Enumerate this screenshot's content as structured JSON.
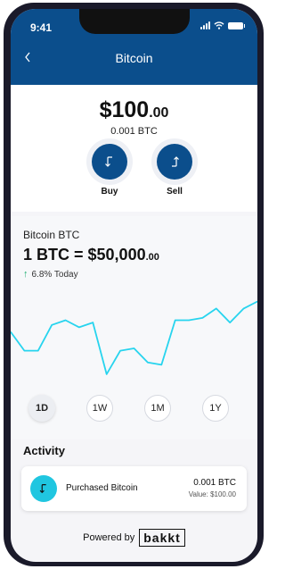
{
  "status_bar": {
    "time": "9:41",
    "signal_icon": "signal-icon",
    "wifi_icon": "wifi-icon",
    "battery_icon": "battery-icon"
  },
  "header": {
    "title": "Bitcoin",
    "back_icon": "chevron-left-icon"
  },
  "balance": {
    "amount_main": "$100",
    "amount_cents": ".00",
    "btc": "0.001 BTC"
  },
  "actions": [
    {
      "label": "Buy",
      "icon": "arrow-down-turn-icon"
    },
    {
      "label": "Sell",
      "icon": "arrow-up-turn-icon"
    }
  ],
  "price": {
    "pair": "Bitcoin BTC",
    "rate_main": "1 BTC = $50,000",
    "rate_cents": ".00",
    "change_arrow": "↑",
    "change": "6.8% Today"
  },
  "chart_data": {
    "type": "line",
    "series": [
      {
        "values": [
          63,
          55,
          55,
          66,
          68,
          65,
          67,
          45,
          55,
          56,
          50,
          49,
          68,
          68,
          69,
          73,
          67,
          73,
          76
        ]
      }
    ],
    "ylim": [
      40,
      80
    ],
    "line_color": "#27d4ee"
  },
  "ranges": {
    "items": [
      "1D",
      "1W",
      "1M",
      "1Y"
    ],
    "selected": "1D"
  },
  "activity": {
    "title": "Activity",
    "transaction": {
      "label": "Purchased Bitcoin",
      "amount": "0.001 BTC",
      "value": "Value: $100.00"
    }
  },
  "footer": {
    "powered_by": "Powered by",
    "brand": "bakkt"
  },
  "colors": {
    "primary": "#0b4e8c",
    "accent": "#20c6e0",
    "positive": "#1fae72"
  }
}
